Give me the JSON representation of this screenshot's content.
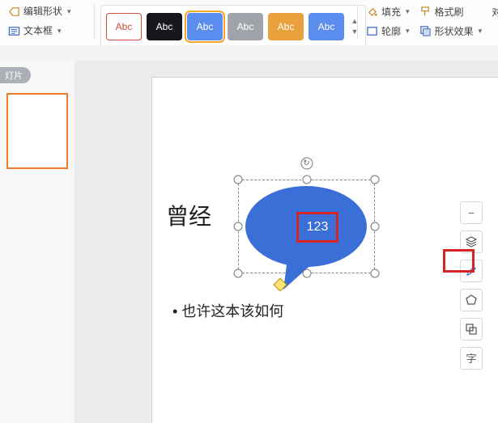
{
  "ribbon": {
    "edit_shape_label": "编辑形状",
    "textbox_label": "文本框",
    "swatches": [
      {
        "label": "Abc",
        "bg": "#ffffff",
        "border": "#d24a3a",
        "color": "#d24a3a"
      },
      {
        "label": "Abc",
        "bg": "#15171c",
        "border": "#15171c",
        "color": "#ffffff"
      },
      {
        "label": "Abc",
        "bg": "#5a8dee",
        "border": "#5a8dee",
        "color": "#ffffff"
      },
      {
        "label": "Abc",
        "bg": "#a0a4aa",
        "border": "#a0a4aa",
        "color": "#ffffff"
      },
      {
        "label": "Abc",
        "bg": "#e9a13b",
        "border": "#e9a13b",
        "color": "#ffffff"
      },
      {
        "label": "Abc",
        "bg": "#5a8dee",
        "border": "#5a8dee",
        "color": "#ffffff"
      }
    ],
    "style_selected_index": 2,
    "fill_label": "填充",
    "format_painter_label": "格式刷",
    "outline_label": "轮廓",
    "shape_effects_label": "形状效果",
    "align_partial": "对"
  },
  "side_pill": "灯片",
  "slide": {
    "title": "曾经",
    "bullet": "• 也许这本该如何",
    "bubble_text": "123"
  },
  "float_toolbar": {
    "text_glyph": "字"
  }
}
